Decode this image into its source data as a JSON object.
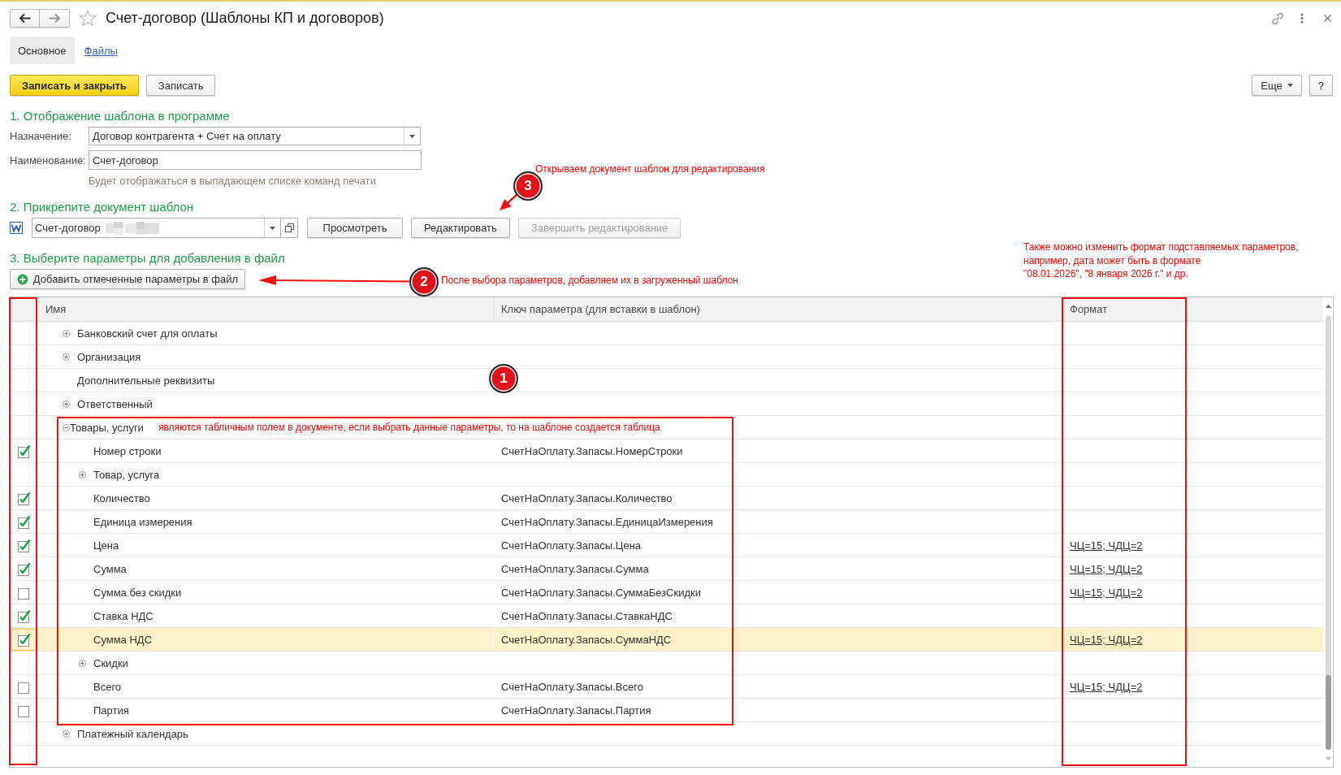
{
  "window": {
    "title": "Счет-договор (Шаблоны КП и договоров)"
  },
  "tabs": [
    {
      "label": "Основное",
      "selected": true
    },
    {
      "label": "Файлы",
      "selected": false
    }
  ],
  "toolbar": {
    "buttons": [
      {
        "label": "Записать и закрыть",
        "kind": "primary"
      },
      {
        "label": "Записать",
        "kind": "default"
      }
    ],
    "more": "Еще",
    "help": "?"
  },
  "display_section": {
    "heading": "1. Отображение шаблона в программе",
    "purpose": {
      "label": "Назначение:",
      "value": "Договор контрагента + Счет на оплату"
    },
    "name": {
      "label": "Наименование:",
      "value": "Счет-договор"
    },
    "hint": "Будет отображаться в выпадающем списке команд печати"
  },
  "attach_section": {
    "heading": "2. Прикрепите документ шаблон",
    "file": {
      "value": "Счет-договор"
    },
    "buttons": [
      {
        "label": "Просмотреть",
        "disabled": false
      },
      {
        "label": "Редактировать",
        "disabled": false
      },
      {
        "label": "Завершить редактирование",
        "disabled": true
      }
    ]
  },
  "params_section": {
    "heading": "3. Выберите параметры для добавления в файл",
    "add_button": "Добавить отмеченные параметры в файл"
  },
  "table": {
    "columns": [
      "Имя",
      "Ключ параметра (для вставки в шаблон)",
      "Формат"
    ],
    "rows": [
      {
        "kind": "group",
        "name": "Банковский счет для оплаты",
        "expanded": false,
        "selected": false
      },
      {
        "kind": "group",
        "name": "Организация",
        "expanded": false,
        "selected": false
      },
      {
        "kind": "label",
        "name": "Дополнительные реквизиты",
        "selected": false
      },
      {
        "kind": "group",
        "name": "Ответственный",
        "expanded": false,
        "selected": false
      },
      {
        "kind": "group",
        "name": "Товары, услуги",
        "expanded": true,
        "selected": false,
        "note": "являются табличным полем в документе, если выбрать данные параметры, то на шаблоне создается таблица",
        "children": [
          {
            "kind": "param",
            "name": "Номер строки",
            "key": "СчетНаОплату.Запасы.НомерСтроки",
            "checked": true,
            "selected": false
          },
          {
            "kind": "group",
            "name": "Товар, услуга",
            "expanded": false,
            "selected": false
          },
          {
            "kind": "param",
            "name": "Количество",
            "key": "СчетНаОплату.Запасы.Количество",
            "checked": true,
            "selected": false
          },
          {
            "kind": "param",
            "name": "Единица измерения",
            "key": "СчетНаОплату.Запасы.ЕдиницаИзмерения",
            "checked": true,
            "selected": false
          },
          {
            "kind": "param",
            "name": "Цена",
            "key": "СчетНаОплату.Запасы.Цена",
            "format": "ЧЦ=15; ЧДЦ=2",
            "checked": true,
            "selected": false
          },
          {
            "kind": "param",
            "name": "Сумма",
            "key": "СчетНаОплату.Запасы.Сумма",
            "format": "ЧЦ=15; ЧДЦ=2",
            "checked": true,
            "selected": false
          },
          {
            "kind": "param",
            "name": "Сумма без скидки",
            "key": "СчетНаОплату.Запасы.СуммаБезСкидки",
            "format": "ЧЦ=15; ЧДЦ=2",
            "checked": false,
            "selected": false
          },
          {
            "kind": "param",
            "name": "Ставка НДС",
            "key": "СчетНаОплату.Запасы.СтавкаНДС",
            "checked": true,
            "selected": false
          },
          {
            "kind": "param",
            "name": "Сумма НДС",
            "key": "СчетНаОплату.Запасы.СуммаНДС",
            "format": "ЧЦ=15; ЧДЦ=2",
            "checked": true,
            "selected": true
          },
          {
            "kind": "group",
            "name": "Скидки",
            "expanded": false,
            "selected": false
          },
          {
            "kind": "param",
            "name": "Всего",
            "key": "СчетНаОплату.Запасы.Всего",
            "format": "ЧЦ=15; ЧДЦ=2",
            "checked": false,
            "selected": false
          },
          {
            "kind": "param",
            "name": "Партия",
            "key": "СчетНаОплату.Запасы.Партия",
            "checked": false,
            "selected": false
          }
        ]
      },
      {
        "kind": "group",
        "name": "Платежный календарь",
        "expanded": false,
        "selected": false
      }
    ]
  },
  "annotations": {
    "steps": [
      {
        "number": "1"
      },
      {
        "number": "2",
        "note": "После выбора параметров, добавляем их в загруженный шаблон"
      },
      {
        "number": "3",
        "note": "Открываем документ шаблон для редактирования"
      }
    ],
    "format_note": [
      "Также можно изменить формат подставляемых параметров,",
      "например, дата может быть в формате",
      "\"08.01.2026\", \"8 января 2026 г.\" и др."
    ]
  }
}
